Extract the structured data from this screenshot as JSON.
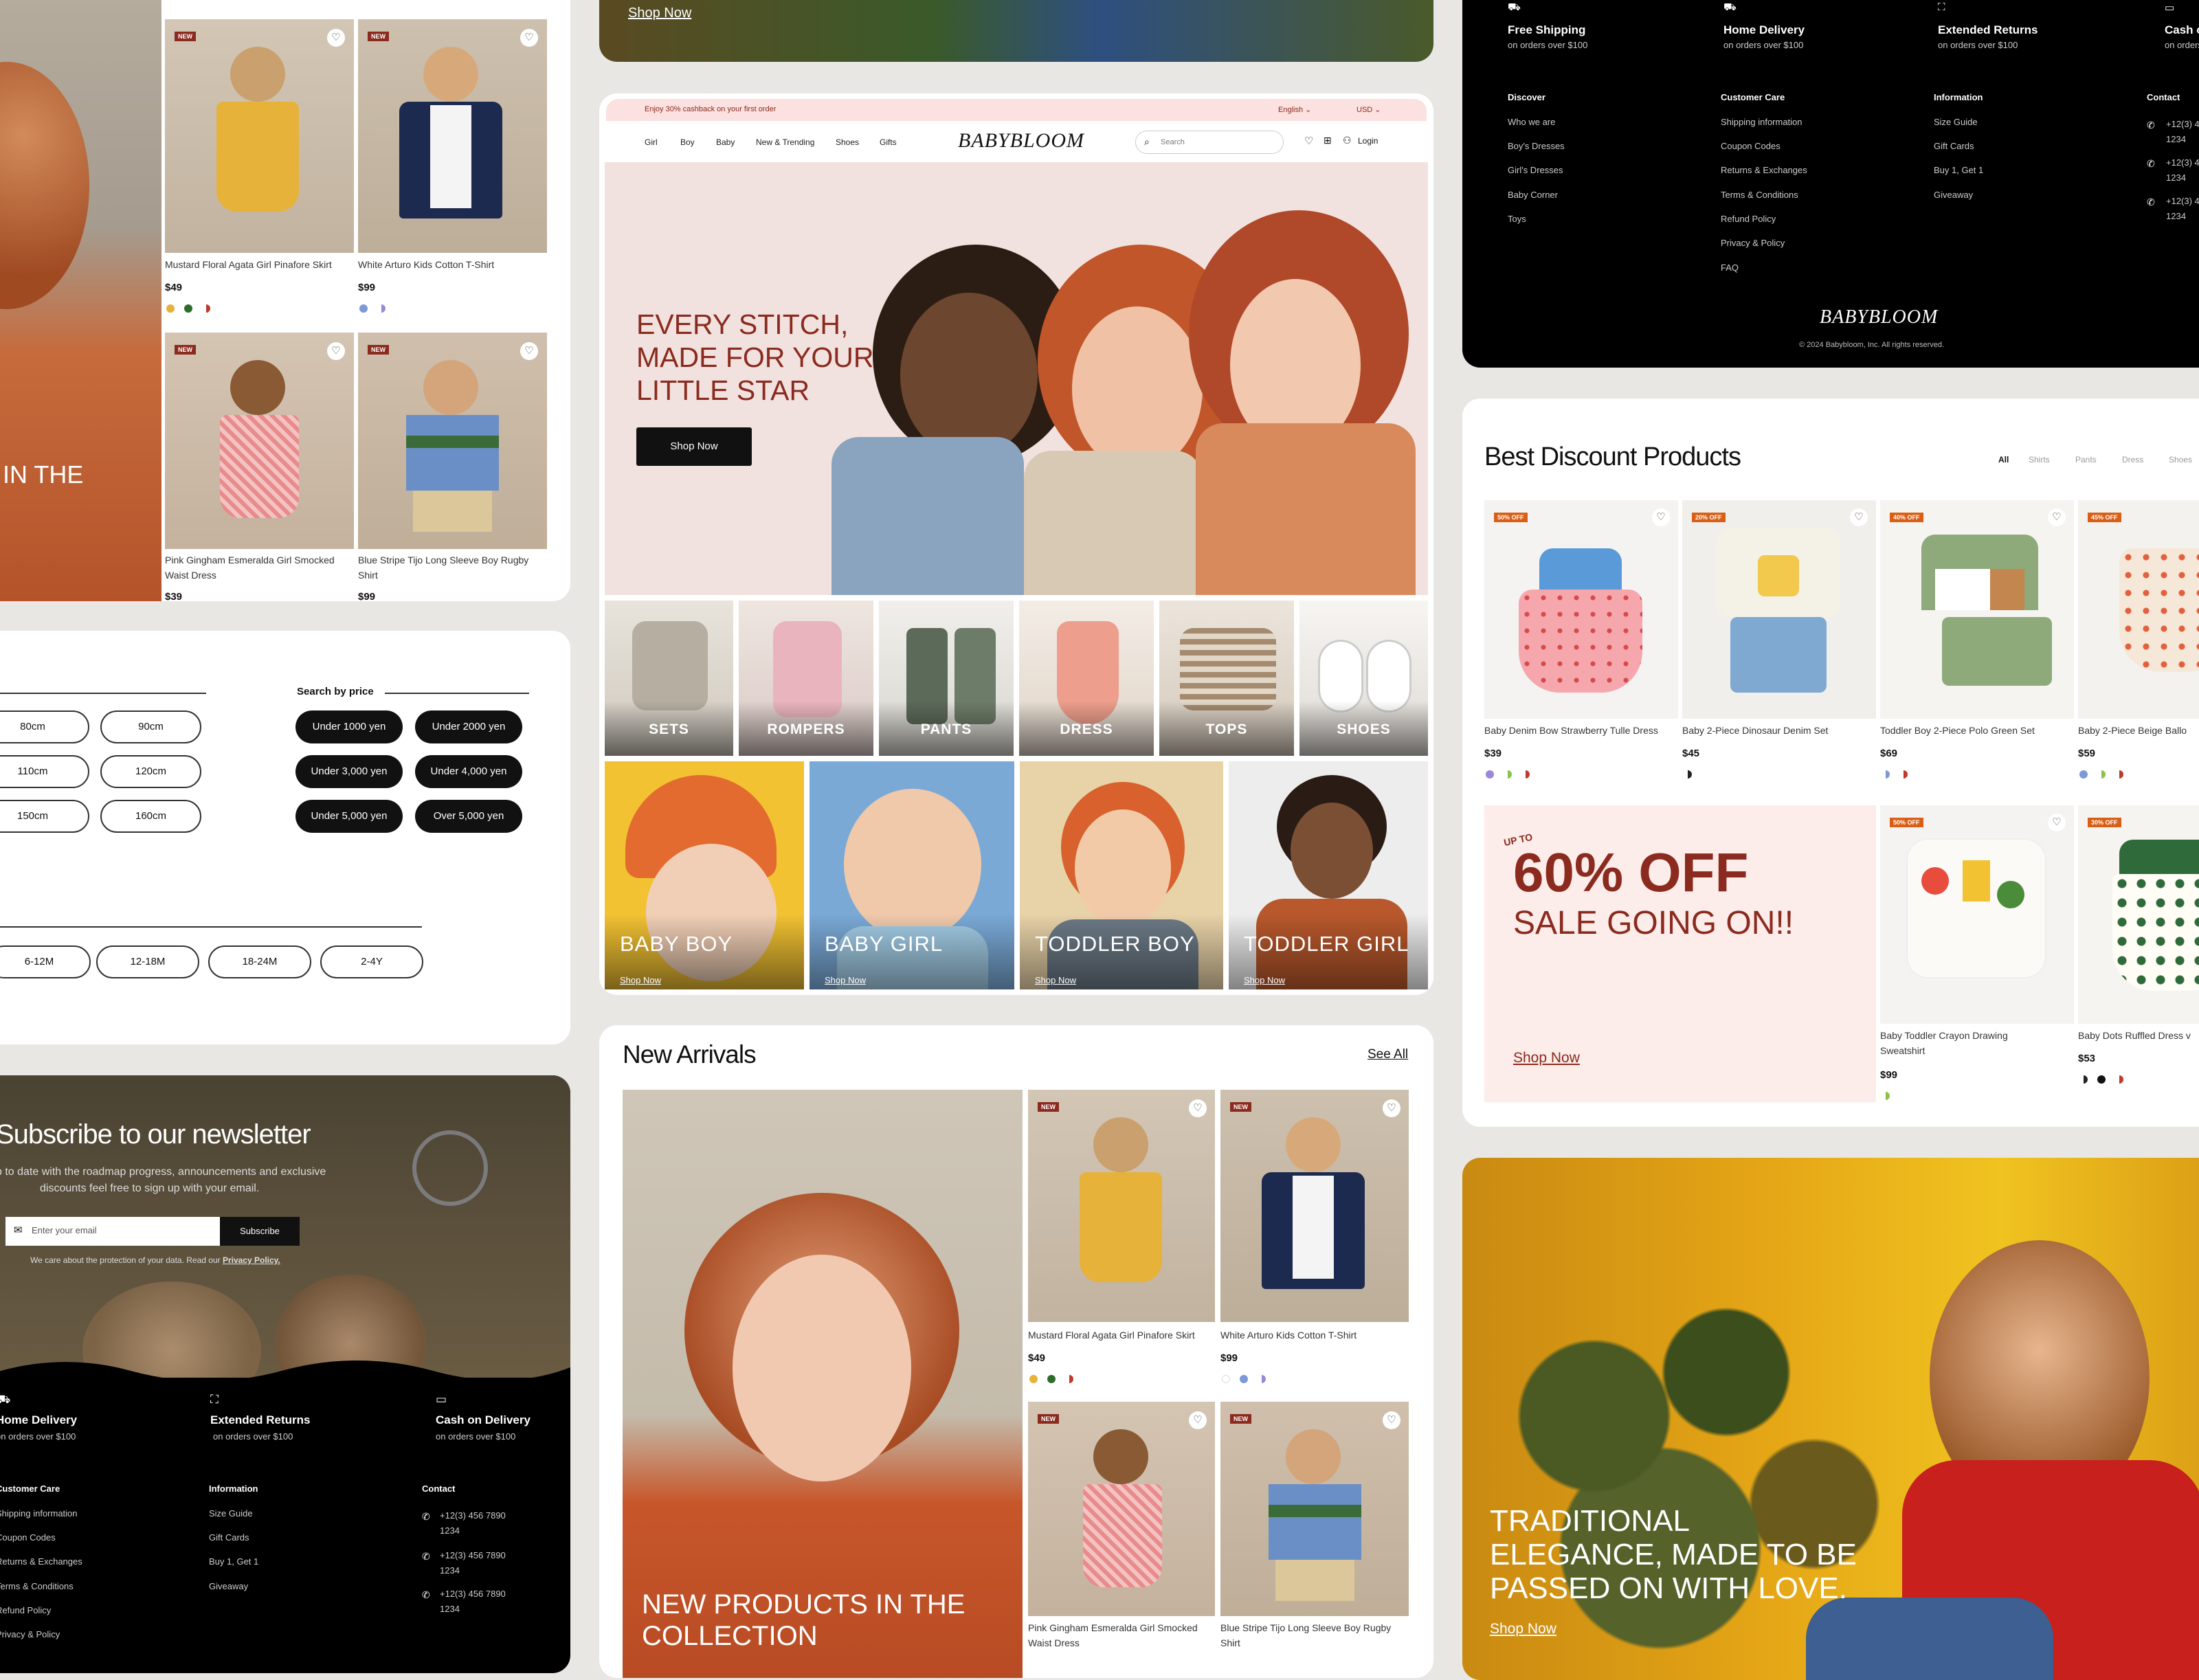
{
  "colors": {
    "accent": "#8b2a1e",
    "promo_bg": "#fbe1df",
    "sale_bg": "#fcecea",
    "footer_bg": "#000000",
    "discount_badge": "#d95f16",
    "page_bg": "#e9e7e4"
  },
  "hero_left": {
    "text": "IN THE"
  },
  "top_products": [
    {
      "badge": "NEW",
      "name": "Mustard Floral Agata Girl Pinafore Skirt",
      "price": "$49",
      "colors": [
        "#e6b23a",
        "#2f6b2a",
        "#c0392b"
      ]
    },
    {
      "badge": "NEW",
      "name": "White Arturo Kids Cotton T-Shirt",
      "price": "$99",
      "colors": [
        "#7c9ad6",
        "#9b87d9"
      ]
    },
    {
      "badge": "NEW",
      "name": "Pink Gingham Esmeralda Girl Smocked Waist Dress",
      "price": "$39"
    },
    {
      "badge": "NEW",
      "name": "Blue Stripe Tijo Long Sleeve Boy Rugby Shirt",
      "price": "$99"
    }
  ],
  "filters": {
    "sizes": [
      "80cm",
      "90cm",
      "110cm",
      "120cm",
      "150cm",
      "160cm"
    ],
    "price_title": "Search by price",
    "prices": [
      "Under 1000 yen",
      "Under 2000 yen",
      "Under 3,000 yen",
      "Under 4,000 yen",
      "Under 5,000 yen",
      "Over 5,000 yen"
    ],
    "ages": [
      "6-12M",
      "12-18M",
      "18-24M",
      "2-4Y"
    ]
  },
  "newsletter": {
    "title": "Subscribe to our newsletter",
    "desc1": "p to date with the roadmap progress, announcements and exclusive",
    "desc2": "discounts feel free to sign up with your email.",
    "placeholder": "Enter your email",
    "button": "Subscribe",
    "privacy_prefix": "We care about the protection of your data. Read our ",
    "privacy_link": "Privacy Policy."
  },
  "footer_left": {
    "features": [
      {
        "title": "Home Delivery",
        "sub": "on orders over $100",
        "icon": "truck-icon"
      },
      {
        "title": "Extended Returns",
        "sub": "on orders over $100",
        "icon": "return-box-icon"
      },
      {
        "title": "Cash on Delivery",
        "sub": "on orders over $100",
        "icon": "cash-icon"
      }
    ],
    "customer_care_title": "Customer Care",
    "customer_care": [
      "Shipping information",
      "Coupon Codes",
      "Returns & Exchanges",
      "Terms & Conditions",
      "Refund Policy",
      "Privacy & Policy"
    ],
    "information_title": "Information",
    "information": [
      "Size Guide",
      "Gift Cards",
      "Buy 1, Get 1",
      "Giveaway"
    ],
    "contact_title": "Contact",
    "contacts": [
      "+12(3) 456 7890 1234",
      "+12(3) 456 7890 1234",
      "+12(3) 456 7890 1234"
    ]
  },
  "banner_top": {
    "shop_now": "Shop Now"
  },
  "site": {
    "promo": "Enjoy 30% cashback on your first order",
    "language": "English",
    "currency": "USD",
    "nav": [
      "Girl",
      "Boy",
      "Baby",
      "New & Trending",
      "Shoes",
      "Gifts"
    ],
    "logo": "BABYBLOOM",
    "search_placeholder": "Search",
    "login": "Login",
    "hero_line1": "EVERY STITCH,",
    "hero_line2": "MADE FOR YOUR",
    "hero_line3": "LITTLE STAR",
    "hero_button": "Shop Now",
    "categories": [
      "SETS",
      "ROMPERS",
      "PANTS",
      "DRESS",
      "TOPS",
      "SHOES"
    ],
    "ages": [
      {
        "label": "BABY BOY",
        "shop": "Shop Now"
      },
      {
        "label": "BABY GIRL",
        "shop": "Shop Now"
      },
      {
        "label": "TODDLER BOY",
        "shop": "Shop Now"
      },
      {
        "label": "TODDLER GIRL",
        "shop": "Shop Now"
      }
    ]
  },
  "new_arrivals": {
    "title": "New Arrivals",
    "see_all": "See All",
    "feature_line1": "NEW PRODUCTS IN THE",
    "feature_line2": "COLLECTION",
    "products": [
      {
        "badge": "NEW",
        "name": "Mustard Floral Agata Girl Pinafore Skirt",
        "price": "$49",
        "colors": [
          "#e6b23a",
          "#2f6b2a",
          "#c0392b"
        ]
      },
      {
        "badge": "NEW",
        "name": "White Arturo Kids Cotton T-Shirt",
        "price": "$99",
        "colors": [
          "#ffffff",
          "#7c9ad6",
          "#9b87d9"
        ]
      },
      {
        "badge": "NEW",
        "name": "Pink Gingham Esmeralda Girl Smocked Waist Dress"
      },
      {
        "badge": "NEW",
        "name": "Blue Stripe Tijo Long Sleeve Boy Rugby Shirt"
      }
    ]
  },
  "footer_right": {
    "features": [
      {
        "title": "Free Shipping",
        "sub": "on orders over $100",
        "icon": "truck-icon"
      },
      {
        "title": "Home Delivery",
        "sub": "on orders over $100",
        "icon": "truck-icon"
      },
      {
        "title": "Extended Returns",
        "sub": "on orders over $100",
        "icon": "return-box-icon"
      },
      {
        "title": "Cash o",
        "sub": "on orders",
        "icon": "cash-icon"
      }
    ],
    "discover_title": "Discover",
    "discover": [
      "Who we are",
      "Boy's Dresses",
      "Girl's Dresses",
      "Baby Corner",
      "Toys"
    ],
    "customer_care_title": "Customer Care",
    "customer_care": [
      "Shipping information",
      "Coupon Codes",
      "Returns & Exchanges",
      "Terms & Conditions",
      "Refund Policy",
      "Privacy & Policy",
      "FAQ"
    ],
    "information_title": "Information",
    "information": [
      "Size Guide",
      "Gift Cards",
      "Buy 1, Get 1",
      "Giveaway"
    ],
    "contact_title": "Contact",
    "contacts": [
      "+12(3) 4 1234",
      "+12(3) 4 1234",
      "+12(3) 4 1234"
    ],
    "logo": "BABYBLOOM",
    "copyright": "© 2024 Babybloom, Inc. All rights reserved."
  },
  "discount": {
    "title": "Best Discount Products",
    "tabs": [
      "All",
      "Shirts",
      "Pants",
      "Dress",
      "Shoes"
    ],
    "products": [
      {
        "badge": "50% OFF",
        "name": "Baby Denim Bow Strawberry Tulle Dress",
        "price": "$39",
        "colors": [
          "#9b87d9",
          "#8bc34a",
          "#c0392b"
        ]
      },
      {
        "badge": "20% OFF",
        "name": "Baby 2-Piece Dinosaur Denim Set",
        "price": "$45",
        "colors": [
          "#222222"
        ]
      },
      {
        "badge": "40% OFF",
        "name": "Toddler Boy 2-Piece Polo Green Set",
        "price": "$69",
        "colors": [
          "#7c9ad6",
          "#c0392b"
        ]
      },
      {
        "badge": "45% OFF",
        "name": "Baby 2-Piece Beige Ballo",
        "price": "$59",
        "colors": [
          "#7c9ad6",
          "#8bc34a",
          "#c0392b"
        ]
      },
      {
        "badge": "50% OFF",
        "name": "Baby Toddler Crayon Drawing Sweatshirt",
        "price": "$99",
        "colors": [
          "#8bc34a"
        ]
      },
      {
        "badge": "30% OFF",
        "name": "Baby Dots Ruffled Dress v",
        "price": "$53",
        "colors": [
          "#222222",
          "#111111",
          "#c0392b"
        ]
      }
    ],
    "sale_upto": "UP TO",
    "sale_big": "60% OFF",
    "sale_sub": "SALE GOING ON!!",
    "sale_shop": "Shop Now"
  },
  "banner_bottom": {
    "line1": "TRADITIONAL",
    "line2": "ELEGANCE, MADE TO BE",
    "line3": "PASSED ON WITH LOVE.",
    "shop": "Shop Now"
  }
}
